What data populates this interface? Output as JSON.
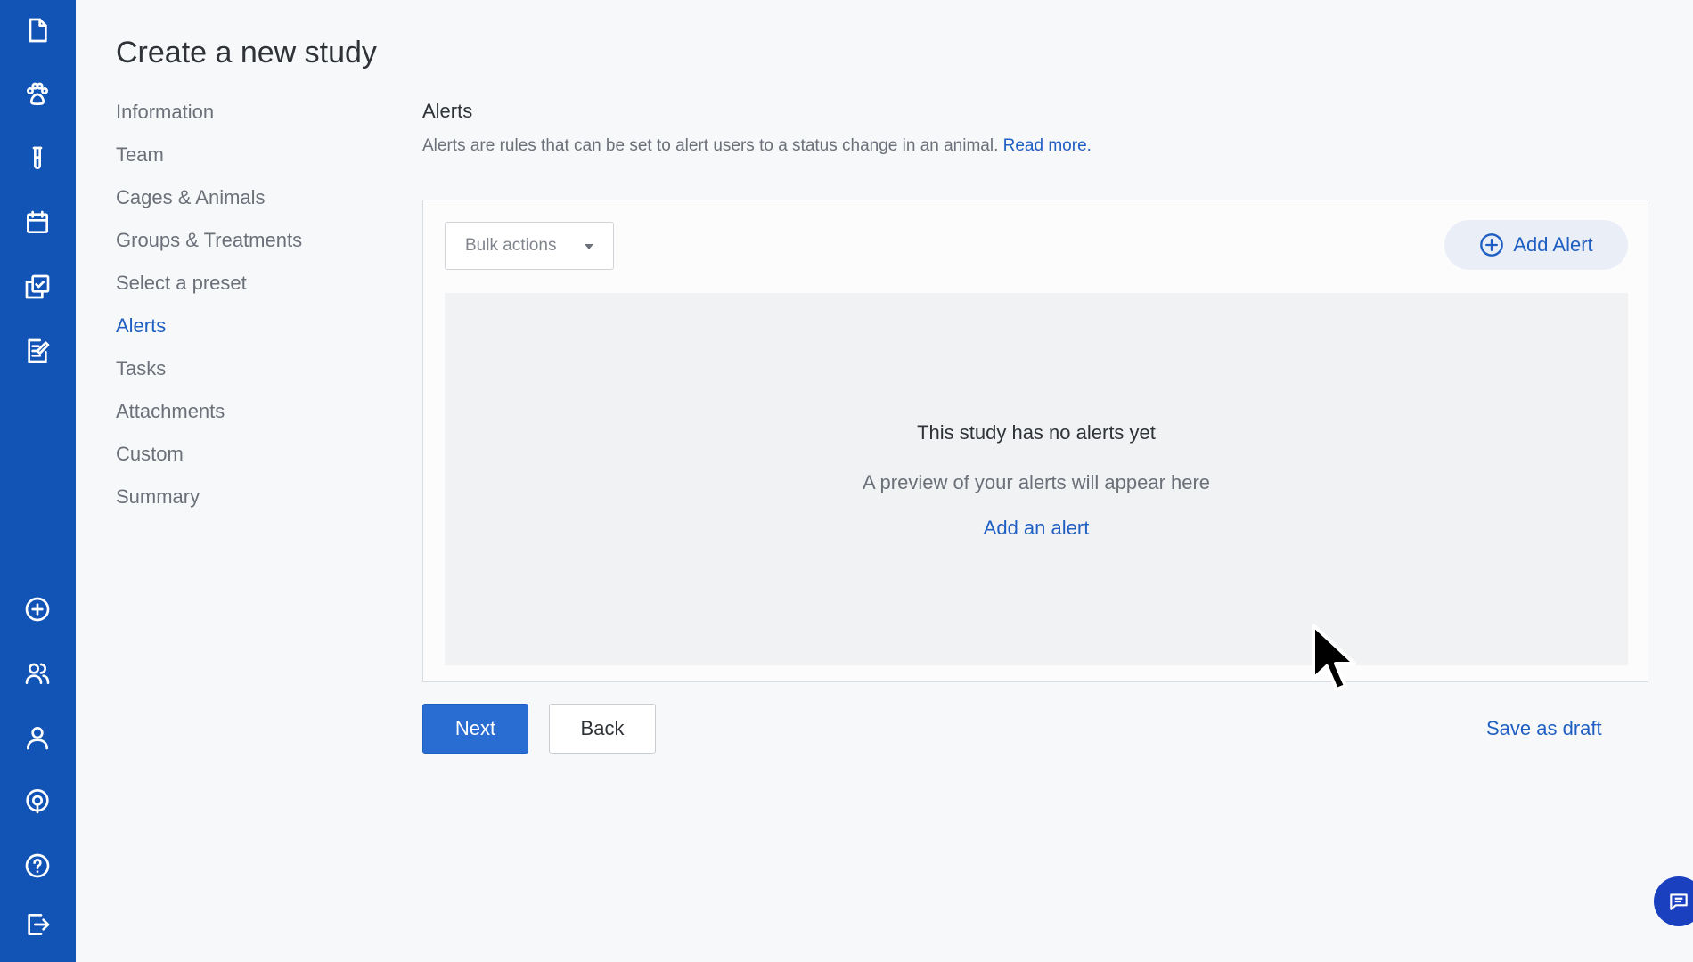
{
  "sidebar_icons": [
    "file-icon",
    "paw-icon",
    "test-tube-icon",
    "calendar-icon",
    "copy-check-icon",
    "edit-note-icon",
    "plus-circle-icon",
    "users-icon",
    "user-icon",
    "support-icon",
    "help-icon",
    "logout-icon"
  ],
  "page": {
    "title": "Create a new study"
  },
  "steps": [
    {
      "label": "Information",
      "active": false
    },
    {
      "label": "Team",
      "active": false
    },
    {
      "label": "Cages & Animals",
      "active": false
    },
    {
      "label": "Groups & Treatments",
      "active": false
    },
    {
      "label": "Select a preset",
      "active": false
    },
    {
      "label": "Alerts",
      "active": true
    },
    {
      "label": "Tasks",
      "active": false
    },
    {
      "label": "Attachments",
      "active": false
    },
    {
      "label": "Custom",
      "active": false
    },
    {
      "label": "Summary",
      "active": false
    }
  ],
  "alerts": {
    "title": "Alerts",
    "description": "Alerts are rules that can be set to alert users to a status change in an animal.",
    "read_more": "Read more.",
    "bulk_actions": "Bulk actions",
    "add_alert": "Add Alert",
    "empty_title": "This study has no alerts yet",
    "empty_subtitle": "A preview of your alerts will appear here",
    "empty_link": "Add an alert"
  },
  "actions": {
    "next": "Next",
    "back": "Back",
    "save_draft": "Save as draft"
  },
  "colors": {
    "rail": "#1254b6",
    "accent": "#1f5fc2",
    "primary_button": "#2a6dd2",
    "background": "#f7f8fa"
  }
}
